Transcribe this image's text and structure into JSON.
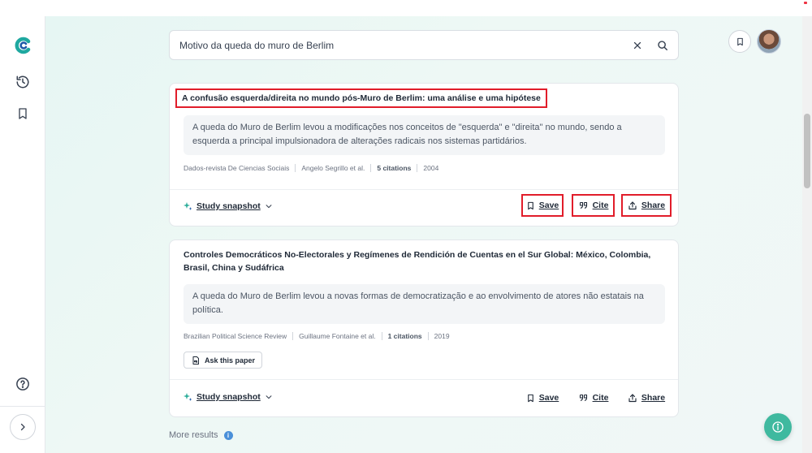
{
  "search": {
    "query": "Motivo da queda do muro de Berlim"
  },
  "results": [
    {
      "title": "A confusão esquerda/direita no mundo pós-Muro de Berlim: uma análise e uma hipótese",
      "summary": "A queda do Muro de Berlim levou a modificações nos conceitos de \"esquerda\" e \"direita\" no mundo, sendo a esquerda a principal impulsionadora de alterações radicais nos sistemas partidários.",
      "journal": "Dados-revista De Ciencias Sociais",
      "authors": "Angelo Segrillo et al.",
      "citations": "5 citations",
      "year": "2004"
    },
    {
      "title": "Controles Democráticos No-Electorales y Regímenes de Rendición de Cuentas en el Sur Global: México, Colombia, Brasil, China y Sudáfrica",
      "summary": "A queda do Muro de Berlim levou a novas formas de democratização e ao envolvimento de atores não estatais na política.",
      "journal": "Brazilian Political Science Review",
      "authors": "Guillaume Fontaine et al.",
      "citations": "1 citations",
      "year": "2019"
    }
  ],
  "actions": {
    "study_snapshot": "Study snapshot",
    "save": "Save",
    "cite": "Cite",
    "share": "Share",
    "ask_paper": "Ask this paper"
  },
  "footer": {
    "more_results": "More results"
  },
  "colors": {
    "accent": "#3fb99f",
    "highlight_box": "#e11d2a",
    "info": "#4a90d9"
  }
}
